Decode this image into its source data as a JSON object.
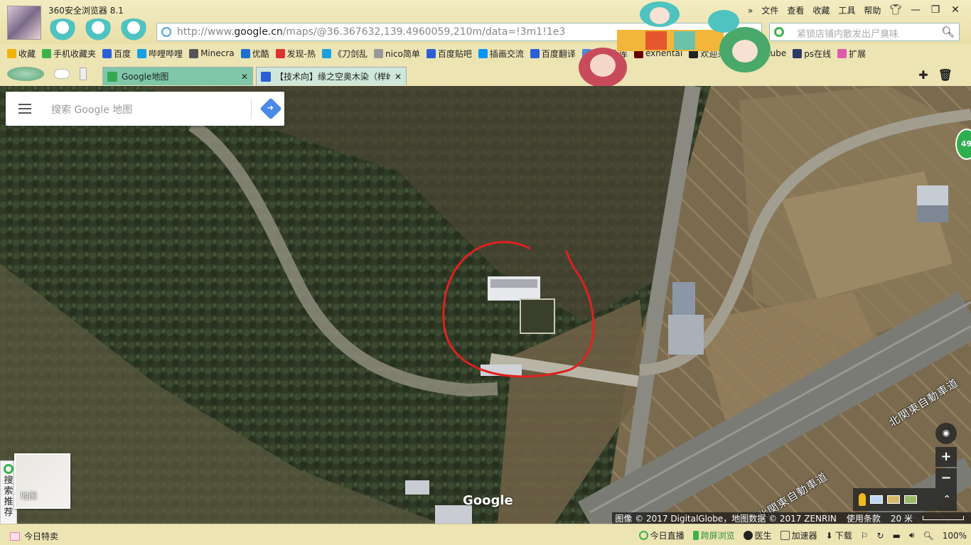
{
  "app": {
    "title": "360安全浏览器 8.1",
    "menus": [
      "文件",
      "查看",
      "收藏",
      "工具",
      "帮助"
    ],
    "window_controls": [
      "shirt-icon",
      "minimize-icon",
      "maximize-icon",
      "close-icon"
    ]
  },
  "address": {
    "url_prefix": "http://www.",
    "url_domain": "google.cn",
    "url_rest": "/maps/@36.367632,139.4960059,210m/data=!3m1!1e3"
  },
  "search": {
    "placeholder": "紧锁店铺内散发出尸臭味"
  },
  "bookmarks": [
    {
      "label": "收藏",
      "icon": "star-icon",
      "color": "#f0b400"
    },
    {
      "label": "手机收藏夹",
      "icon": "phone-icon",
      "color": "#3bb34a"
    },
    {
      "label": "百度",
      "icon": "paw-icon",
      "color": "#2a5fd8"
    },
    {
      "label": "哔哩哔哩",
      "icon": "bilibili-icon",
      "color": "#19a0e0"
    },
    {
      "label": "Minecra",
      "icon": "minecraft-icon",
      "color": "#555555"
    },
    {
      "label": "优酷",
      "icon": "youku-icon",
      "color": "#1e6fd0"
    },
    {
      "label": "发现-热",
      "icon": "weibo-icon",
      "color": "#e03030"
    },
    {
      "label": "《刀剑乱",
      "icon": "bilibili-icon",
      "color": "#19a0e0"
    },
    {
      "label": "nico简单",
      "icon": "page-icon",
      "color": "#999999"
    },
    {
      "label": "百度贴吧",
      "icon": "paw-icon",
      "color": "#2a5fd8"
    },
    {
      "label": "插画交流",
      "icon": "pixiv-icon",
      "color": "#0096fa"
    },
    {
      "label": "百度翻译",
      "icon": "translate-icon",
      "color": "#2a5fd8"
    },
    {
      "label": "绅士仓库",
      "icon": "warehouse-icon",
      "color": "#4a8adf"
    },
    {
      "label": "exhentai",
      "icon": "eh-icon",
      "color": "#660000"
    },
    {
      "label": "欢迎来到",
      "icon": "steam-icon",
      "color": "#222222"
    },
    {
      "label": "Youtube",
      "icon": "youtube-icon",
      "color": "#e02020"
    },
    {
      "label": "ps在线",
      "icon": "ps-icon",
      "color": "#2a3a6a"
    },
    {
      "label": "扩展",
      "icon": "extension-icon",
      "color": "#e05ab0"
    }
  ],
  "tabs": [
    {
      "label": "Google地图",
      "active": true,
      "icon_color": "#34a853"
    },
    {
      "label": "【技术向】缘之空奥木染（榉岭",
      "active": false,
      "icon_color": "#2a5fd8"
    }
  ],
  "map": {
    "search_placeholder": "搜索 Google 地图",
    "badge_number": "49",
    "minimap_label": "地图",
    "side_panel_text": "搜索推荐",
    "logo": "Google",
    "attribution": "图像 © 2017 DigitalGlobe，地图数据 © 2017 ZENRIN",
    "terms": "使用条款",
    "scale": "20 米",
    "road_label_1": "北関東自動車道",
    "road_label_2": "北関東自動車道",
    "zoom_in": "+",
    "zoom_out": "−"
  },
  "status": {
    "left": "今日特卖",
    "items": [
      "今日直播",
      "跨屏浏览",
      "医生",
      "加速器",
      "下载"
    ],
    "zoom": "100%"
  }
}
